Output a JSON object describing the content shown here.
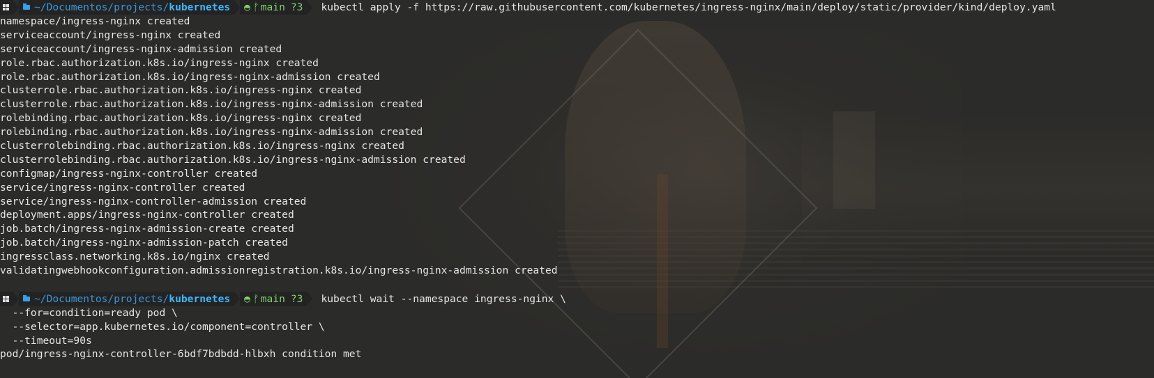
{
  "prompt": {
    "path_prefix": "~/Documentos/projects/",
    "path_current": "kubernetes",
    "git_icon": "github-cat-icon",
    "branch": "main",
    "status": "?3",
    "thin_separator": "〉"
  },
  "command1": "kubectl apply -f https://raw.githubusercontent.com/kubernetes/ingress-nginx/main/deploy/static/provider/kind/deploy.yaml",
  "output1": [
    "namespace/ingress-nginx created",
    "serviceaccount/ingress-nginx created",
    "serviceaccount/ingress-nginx-admission created",
    "role.rbac.authorization.k8s.io/ingress-nginx created",
    "role.rbac.authorization.k8s.io/ingress-nginx-admission created",
    "clusterrole.rbac.authorization.k8s.io/ingress-nginx created",
    "clusterrole.rbac.authorization.k8s.io/ingress-nginx-admission created",
    "rolebinding.rbac.authorization.k8s.io/ingress-nginx created",
    "rolebinding.rbac.authorization.k8s.io/ingress-nginx-admission created",
    "clusterrolebinding.rbac.authorization.k8s.io/ingress-nginx created",
    "clusterrolebinding.rbac.authorization.k8s.io/ingress-nginx-admission created",
    "configmap/ingress-nginx-controller created",
    "service/ingress-nginx-controller created",
    "service/ingress-nginx-controller-admission created",
    "deployment.apps/ingress-nginx-controller created",
    "job.batch/ingress-nginx-admission-create created",
    "job.batch/ingress-nginx-admission-patch created",
    "ingressclass.networking.k8s.io/nginx created",
    "validatingwebhookconfiguration.admissionregistration.k8s.io/ingress-nginx-admission created"
  ],
  "command2": "kubectl wait --namespace ingress-nginx \\",
  "command2_continuation": [
    "  --for=condition=ready pod \\",
    "  --selector=app.kubernetes.io/component=controller \\",
    "  --timeout=90s"
  ],
  "output2": [
    "pod/ingress-nginx-controller-6bdf7bdbdd-hlbxh condition met"
  ],
  "colors": {
    "background": "#2b2b29",
    "prompt_segment": "#232323",
    "path": "#3b96d8",
    "path_current": "#3db8ff",
    "git": "#7fd36a",
    "text": "#e6e6e6"
  }
}
